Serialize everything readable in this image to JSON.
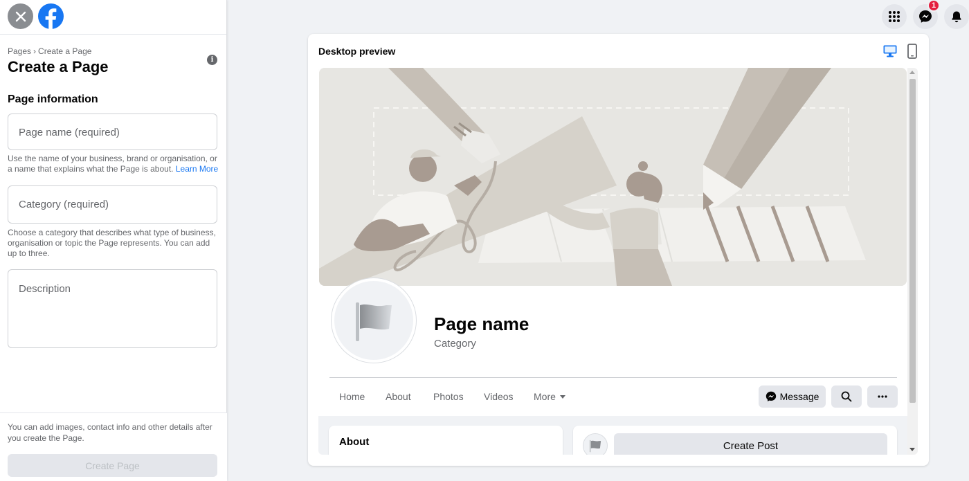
{
  "left_panel": {
    "breadcrumb": [
      "Pages",
      "Create a Page"
    ],
    "breadcrumb_separator": "›",
    "title": "Create a Page",
    "info_icon": "info-icon",
    "section_title": "Page information",
    "fields": {
      "page_name": {
        "placeholder": "Page name (required)",
        "value": ""
      },
      "category": {
        "placeholder": "Category (required)",
        "value": ""
      },
      "description": {
        "placeholder": "Description",
        "value": ""
      }
    },
    "page_name_help": "Use the name of your business, brand or organisation, or a name that explains what the Page is about.",
    "learn_more": "Learn More",
    "category_help": "Choose a category that describes what type of business, organisation or topic the Page represents. You can add up to three.",
    "footer_note": "You can add images, contact info and other details after you create the Page.",
    "create_button": "Create Page"
  },
  "top_icons": {
    "menu": "apps-grid-icon",
    "messenger": "messenger-icon",
    "messenger_badge": "1",
    "notifications": "bell-icon"
  },
  "preview": {
    "title": "Desktop preview",
    "desktop_icon": "desktop-icon",
    "mobile_icon": "mobile-icon",
    "page_name": "Page name",
    "category": "Category",
    "tabs": [
      "Home",
      "About",
      "Photos",
      "Videos",
      "More"
    ],
    "message_button": "Message",
    "about_title": "About",
    "create_post": "Create Post"
  },
  "colors": {
    "accent": "#1877f2",
    "badge": "#e41e3f",
    "button_bg": "#e4e6eb",
    "cover_bg": "#e7e6e2"
  }
}
